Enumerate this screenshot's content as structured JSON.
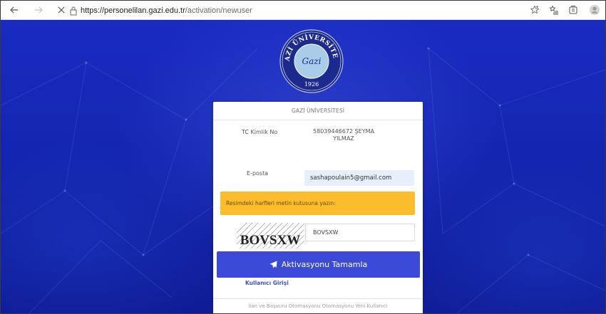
{
  "browser": {
    "url_host": "https://personelilan.gazi.edu.tr",
    "url_path": "/activation/newuser",
    "icons": [
      "back-arrow-icon",
      "forward-arrow-icon",
      "close-icon",
      "lock-icon",
      "star-icon",
      "favorites-icon",
      "collections-icon",
      "profile-icon"
    ]
  },
  "seal": {
    "top_text": "GAZİ ÜNİVERSİTESİ",
    "year": "1926",
    "script": "Gazi"
  },
  "card": {
    "header": "GAZİ ÜNİVERSİTESİ",
    "tc_label": "TC Kimlik No",
    "tc_value_line1": "58039446672 ŞEYMA",
    "tc_value_line2": "YILMAZ",
    "email_label": "E-posta",
    "email_value": "sashapoulain5@gmail.com",
    "alert_text": "Resimdeki harfleri metin kutusuna yazın:",
    "captcha_text": "BOVSXW",
    "captcha_input": "BOVSXW",
    "submit_label": "Aktivasyonu Tamamla",
    "login_link": "Kullanıcı Girişi",
    "footer": "İlan ve Başvuru Otomasyonu Otomasyonu Yeni Kullanıcı"
  },
  "colors": {
    "background": "#1426b0",
    "button": "#3b4bd8",
    "alert": "#fbbd2e",
    "email_field": "#e8effc"
  }
}
